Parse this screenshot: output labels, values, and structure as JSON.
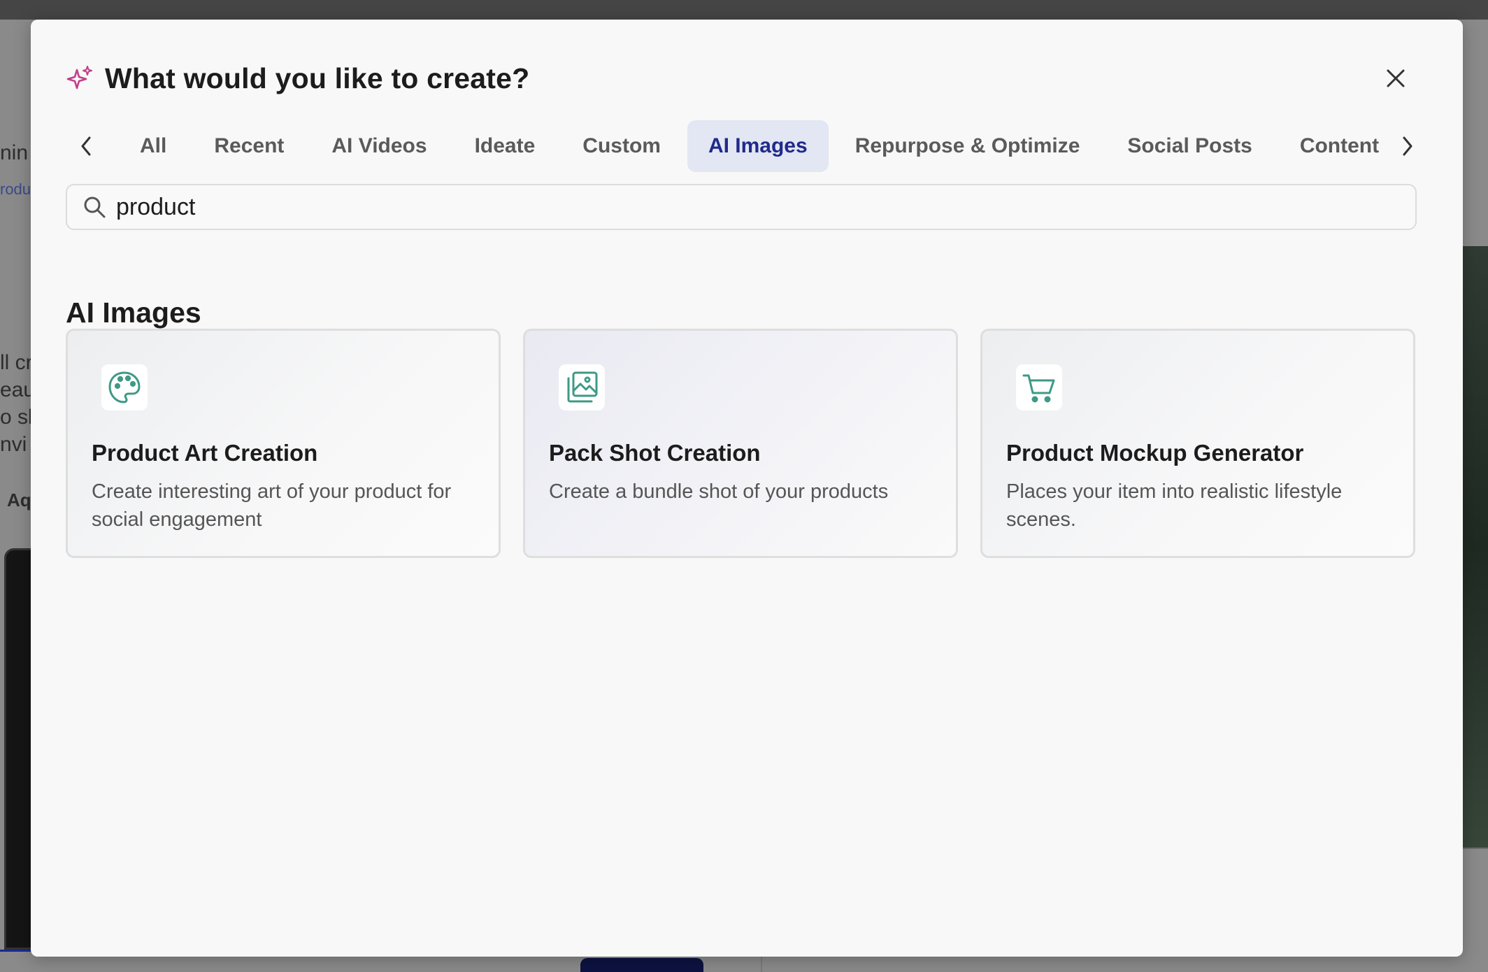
{
  "background": {
    "left_fragments": [
      "nin",
      "rodu",
      "ll cr",
      "eau",
      "o sh",
      "nvi",
      "Aq"
    ]
  },
  "modal": {
    "title": "What would you like to create?",
    "icons": {
      "title_icon": "sparkle-icon",
      "close": "close-icon",
      "prev": "chevron-left-icon",
      "next": "chevron-right-icon",
      "search": "search-icon"
    },
    "colors": {
      "sparkle": "#c2408a",
      "active_tab_bg": "#e3e6f3",
      "active_tab_text": "#1f2a8a",
      "card_icon": "#3d9a85"
    },
    "tabs": [
      {
        "label": "All",
        "active": false
      },
      {
        "label": "Recent",
        "active": false
      },
      {
        "label": "AI Videos",
        "active": false
      },
      {
        "label": "Ideate",
        "active": false
      },
      {
        "label": "Custom",
        "active": false
      },
      {
        "label": "AI Images",
        "active": true
      },
      {
        "label": "Repurpose & Optimize",
        "active": false
      },
      {
        "label": "Social Posts",
        "active": false
      },
      {
        "label": "Content",
        "active": false
      }
    ],
    "search": {
      "value": "product"
    },
    "section": {
      "title": "AI Images",
      "cards": [
        {
          "icon": "palette-icon",
          "title": "Product Art Creation",
          "description": "Create interesting art of your product for social engagement"
        },
        {
          "icon": "image-stack-icon",
          "title": "Pack Shot Creation",
          "description": "Create a bundle shot of your products"
        },
        {
          "icon": "shopping-cart-icon",
          "title": "Product Mockup Generator",
          "description": "Places your item into realistic lifestyle scenes."
        }
      ]
    }
  }
}
